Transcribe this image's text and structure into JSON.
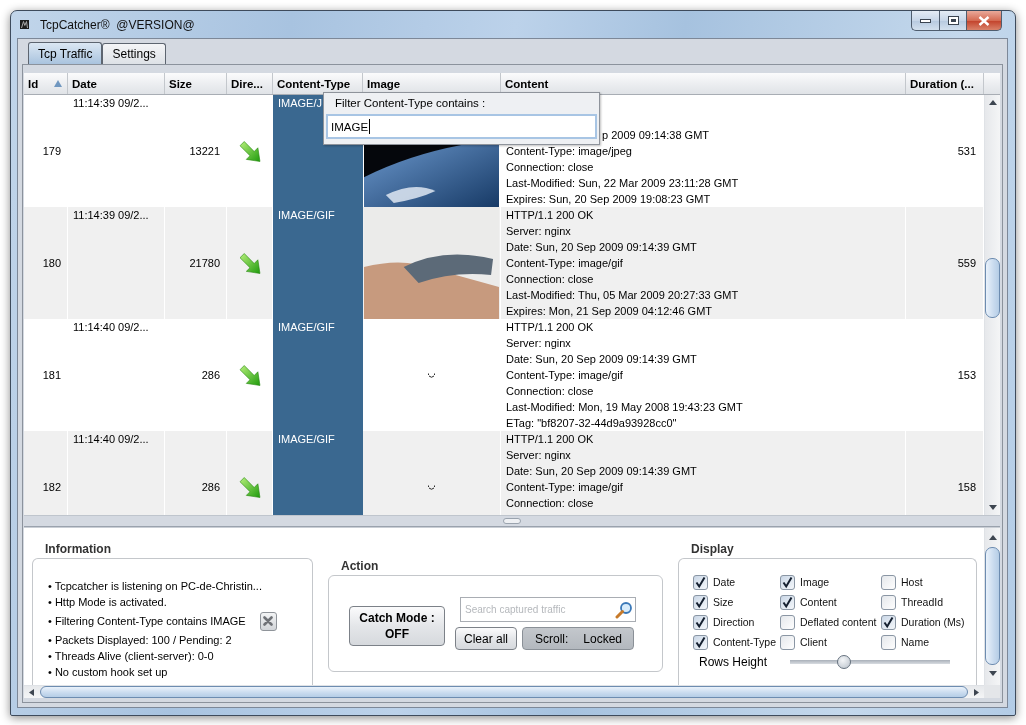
{
  "window": {
    "title": "TcpCatcher®  @VERSION@"
  },
  "tabs": [
    {
      "label": "Tcp Traffic",
      "selected": true
    },
    {
      "label": "Settings",
      "selected": false
    }
  ],
  "table": {
    "columns": [
      {
        "label": "Id",
        "sorted": true,
        "selected": false
      },
      {
        "label": "Date",
        "sorted": false,
        "selected": false
      },
      {
        "label": "Size",
        "sorted": false,
        "selected": false
      },
      {
        "label": "Dire...",
        "sorted": false,
        "selected": false
      },
      {
        "label": "Content-Type",
        "sorted": false,
        "selected": true
      },
      {
        "label": "Image",
        "sorted": false,
        "selected": false
      },
      {
        "label": "Content",
        "sorted": false,
        "selected": false
      },
      {
        "label": "Duration (...",
        "sorted": false,
        "selected": false
      }
    ],
    "rows": [
      {
        "id": "179",
        "date": "11:14:39 09/2...",
        "size": "13221",
        "content_type": "IMAGE/J",
        "image": {
          "kind": "dark_photo"
        },
        "covered": true,
        "content": [
          "p 2009 09:14:38 GMT",
          "Content-Type: image/jpeg",
          "Connection: close",
          "Last-Modified: Sun, 22 Mar 2009 23:11:28 GMT",
          "Expires: Sun, 20 Sep 2009 19:08:23 GMT"
        ],
        "duration": "531"
      },
      {
        "id": "180",
        "date": "11:14:39 09/2...",
        "size": "21780",
        "content_type": "IMAGE/GIF",
        "image": {
          "kind": "light_photo"
        },
        "covered": false,
        "content": [
          "HTTP/1.1 200 OK",
          "Server: nginx",
          "Date: Sun, 20 Sep 2009 09:14:39 GMT",
          "Content-Type: image/gif",
          "Connection: close",
          "Last-Modified: Thu, 05 Mar 2009 20:27:33 GMT",
          "Expires: Mon, 21 Sep 2009 04:12:46 GMT"
        ],
        "duration": "559"
      },
      {
        "id": "181",
        "date": "11:14:40 09/2...",
        "size": "286",
        "content_type": "IMAGE/GIF",
        "image": {
          "kind": "tiny_icon"
        },
        "covered": false,
        "content": [
          "HTTP/1.1 200 OK",
          "Server: nginx",
          "Date: Sun, 20 Sep 2009 09:14:39 GMT",
          "Content-Type: image/gif",
          "Connection: close",
          "Last-Modified: Mon, 19 May 2008 19:43:23 GMT",
          "ETag: \"bf8207-32-44d9a93928cc0\""
        ],
        "duration": "153"
      },
      {
        "id": "182",
        "date": "11:14:40 09/2...",
        "size": "286",
        "content_type": "IMAGE/GIF",
        "image": {
          "kind": "tiny_icon"
        },
        "covered": false,
        "content": [
          "HTTP/1.1 200 OK",
          "Server: nginx",
          "Date: Sun, 20 Sep 2009 09:14:39 GMT",
          "Content-Type: image/gif",
          "Connection: close"
        ],
        "duration": "158"
      }
    ]
  },
  "filter_popup": {
    "label": "Filter Content-Type contains :",
    "value": "IMAGE"
  },
  "information": {
    "title": "Information",
    "items": [
      {
        "text": "• Tcpcatcher is listening on PC-de-Christin...",
        "removable": false
      },
      {
        "text": "• Http Mode is activated.",
        "removable": false
      },
      {
        "text": "• Filtering Content-Type contains IMAGE",
        "removable": true
      },
      {
        "text": "• Packets Displayed: 100 / Pending: 2",
        "removable": false
      },
      {
        "text": "• Threads Alive (client-server): 0-0",
        "removable": false
      },
      {
        "text": "• No custom hook set up",
        "removable": false
      }
    ]
  },
  "action": {
    "title": "Action",
    "catch_mode": {
      "label": "Catch Mode :",
      "value": "OFF"
    },
    "search": {
      "placeholder": "Search captured traffic"
    },
    "clear_button": "Clear all",
    "scroll_toggle": {
      "label": "Scroll:",
      "value": "Locked",
      "selected": true
    }
  },
  "display": {
    "title": "Display",
    "options": [
      {
        "label": "Date",
        "checked": true
      },
      {
        "label": "Image",
        "checked": true
      },
      {
        "label": "Host",
        "checked": false
      },
      {
        "label": "Size",
        "checked": true
      },
      {
        "label": "Content",
        "checked": true
      },
      {
        "label": "ThreadId",
        "checked": false
      },
      {
        "label": "Direction",
        "checked": true
      },
      {
        "label": "Deflated content",
        "checked": false
      },
      {
        "label": "Duration (Ms)",
        "checked": true
      },
      {
        "label": "Content-Type",
        "checked": true
      },
      {
        "label": "Client",
        "checked": false
      },
      {
        "label": "Name",
        "checked": false
      }
    ],
    "rows_height": {
      "label": "Rows Height",
      "level": 0.34
    }
  }
}
